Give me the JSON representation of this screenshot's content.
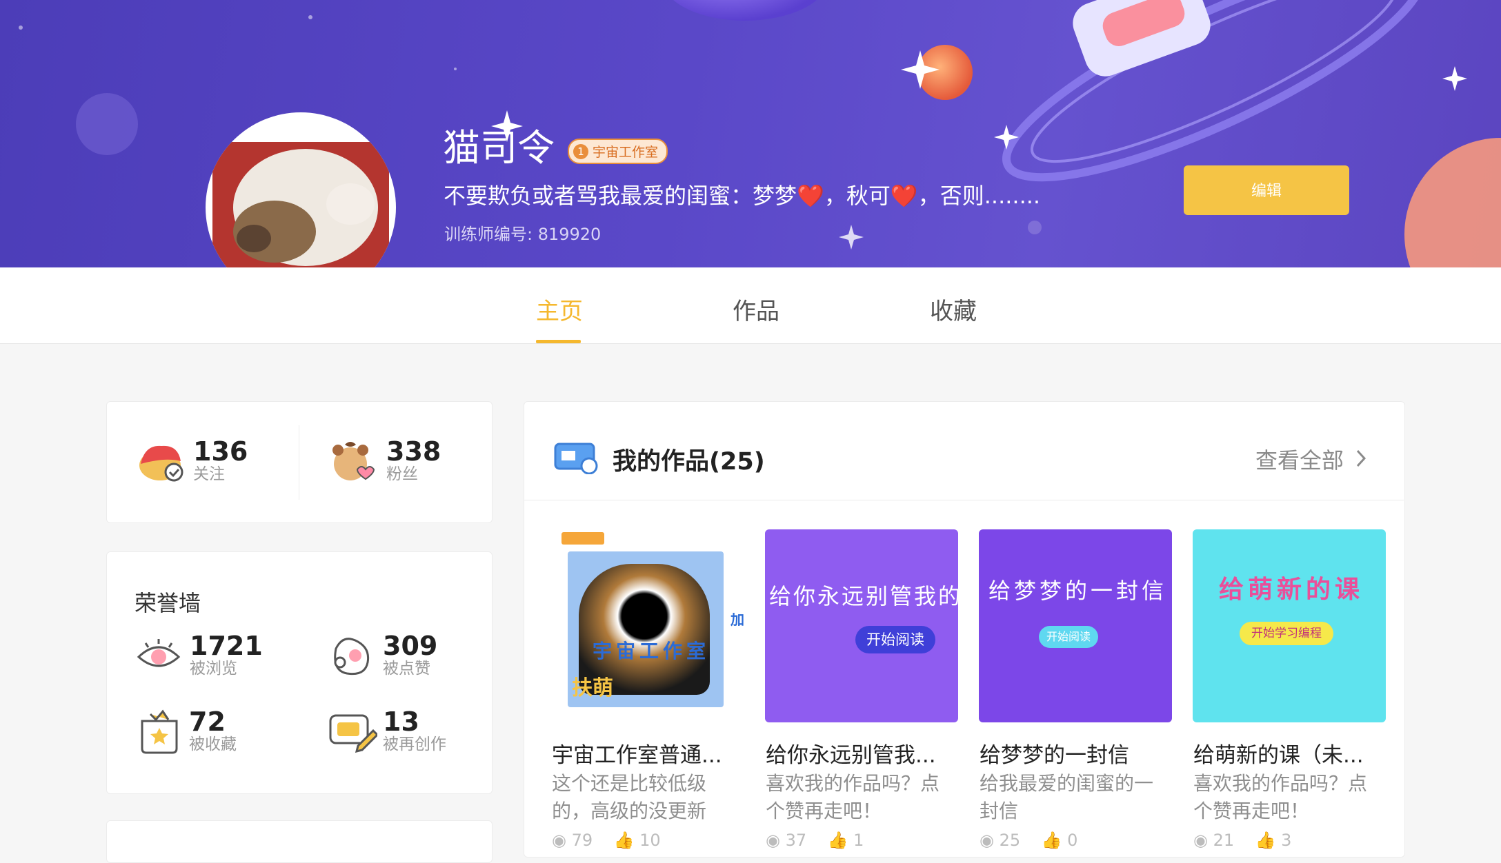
{
  "profile": {
    "name": "猫司令",
    "badge_num": "1",
    "badge_label": "宇宙工作室",
    "bio_part1": "不要欺负或者骂我最爱的闺蜜：梦梦",
    "bio_part2": "，秋可",
    "bio_part3": "，否则........",
    "heart": "❤️",
    "uid": "训练师编号: 819920",
    "edit_label": "编辑"
  },
  "tabs": [
    "主页",
    "作品",
    "收藏"
  ],
  "social": {
    "following": {
      "value": "136",
      "label": "关注"
    },
    "fans": {
      "value": "338",
      "label": "粉丝"
    }
  },
  "honor": {
    "title": "荣誉墙",
    "views": {
      "value": "1721",
      "label": "被浏览"
    },
    "likes": {
      "value": "309",
      "label": "被点赞"
    },
    "favs": {
      "value": "72",
      "label": "被收藏"
    },
    "remix": {
      "value": "13",
      "label": "被再创作"
    }
  },
  "works": {
    "title": "我的作品(25)",
    "view_all": "查看全部",
    "items": [
      {
        "title": "宇宙工作室普通...",
        "desc": "这个还是比较低级的，高级的没更新",
        "views": "79",
        "likes": "10",
        "thumb_text": "宇宙工作室",
        "thumb_sub": "扶萌",
        "side_text": "加"
      },
      {
        "title": "给你永远别管我...",
        "desc": "喜欢我的作品吗？点个赞再走吧！",
        "views": "37",
        "likes": "1",
        "thumb_text": "给你永远别管我的",
        "button": "开始阅读",
        "color": "#8f5cf0"
      },
      {
        "title": "给梦梦的一封信",
        "desc": "给我最爱的闺蜜的一封信",
        "views": "25",
        "likes": "0",
        "thumb_text": "给梦梦的一封信",
        "button": "开始阅读",
        "color": "#7c47e8"
      },
      {
        "title": "给萌新的课（未...",
        "desc": "喜欢我的作品吗？点个赞再走吧！",
        "views": "21",
        "likes": "3",
        "thumb_text": "给萌新的课",
        "button": "开始学习编程",
        "color": "#5fe3ee"
      }
    ]
  }
}
